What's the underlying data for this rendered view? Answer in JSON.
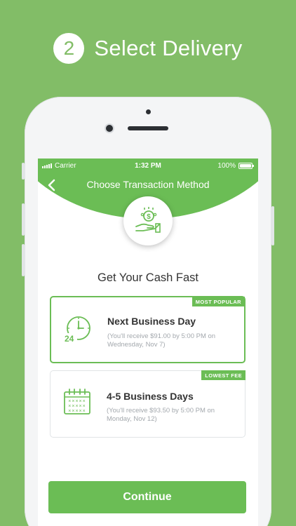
{
  "hero": {
    "step_number": "2",
    "title": "Select Delivery"
  },
  "status_bar": {
    "carrier": "Carrier",
    "time": "1:32 PM",
    "battery": "100%"
  },
  "nav": {
    "title": "Choose Transaction Method",
    "back_icon": "chevron-left-icon"
  },
  "header_icon": "cash-hand-icon",
  "section_title": "Get Your Cash Fast",
  "options": [
    {
      "badge": "MOST POPULAR",
      "title": "Next Business Day",
      "description": "(You'll receive $91.00 by 5:00 PM on Wednesday, Nov 7)",
      "icon": "clock-24-icon",
      "selected": true
    },
    {
      "badge": "LOWEST FEE",
      "title": "4-5 Business Days",
      "description": "(You'll receive $93.50 by 5:00 PM on Monday, Nov 12)",
      "icon": "calendar-icon",
      "selected": false
    }
  ],
  "continue_label": "Continue",
  "colors": {
    "background": "#82bd67",
    "accent": "#6bbd55",
    "text": "#333333",
    "muted": "#a3a8ad"
  }
}
